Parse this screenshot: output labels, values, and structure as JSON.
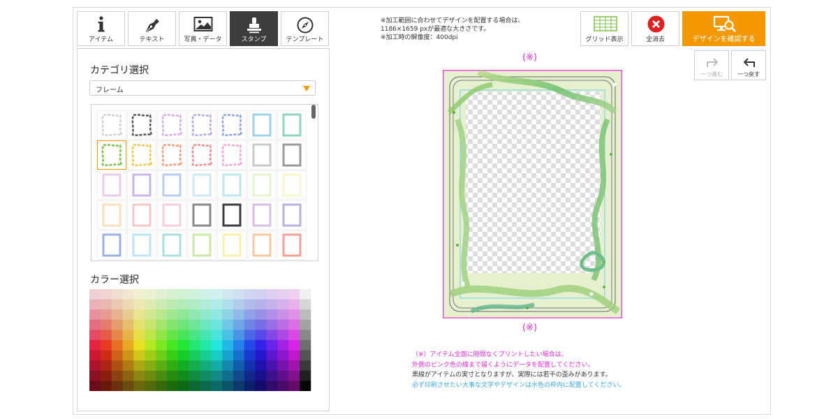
{
  "tabs": [
    {
      "label": "アイテム",
      "icon": "info-icon"
    },
    {
      "label": "テキスト",
      "icon": "pen-nib-icon"
    },
    {
      "label": "写真・データ",
      "icon": "image-icon"
    },
    {
      "label": "スタンプ",
      "icon": "stamp-icon",
      "active": true
    },
    {
      "label": "テンプレート",
      "icon": "compass-icon"
    }
  ],
  "category": {
    "heading": "カテゴリ選択",
    "selected": "フレーム"
  },
  "color": {
    "heading": "カラー選択"
  },
  "top_note": {
    "line1": "※加工範囲に合わせてデザインを配置する場合は、",
    "line2": "1186×1659 pxが最適な大きさです。",
    "line3": "※加工時の解像度：400dpi"
  },
  "toolbar": {
    "grid_label": "グリッド表示",
    "clear_label": "全消去",
    "confirm_label": "デザインを確認する",
    "redo_label": "一つ進む",
    "undo_label": "一つ戻す"
  },
  "canvas": {
    "mark_top": "(※)",
    "mark_bottom": "(※)"
  },
  "notes": {
    "line1": "（※）アイテム全面に隙間なくプリントしたい場合は、",
    "line2": "外側のピンク色の線まで届くようにデータを配置してください。",
    "line3": "黒線がアイテムの実寸となりますが、実際には若干の歪みがあります。",
    "line4": "必ず印刷させたい大事な文字やデザインは水色の枠内に配置してください。"
  },
  "colors": {
    "accent": "#f39800",
    "guide_pink": "#e455d8",
    "guide_blue": "#7fd6ec",
    "clear_red": "#e02020",
    "tab_active": "#3d3d3d"
  }
}
